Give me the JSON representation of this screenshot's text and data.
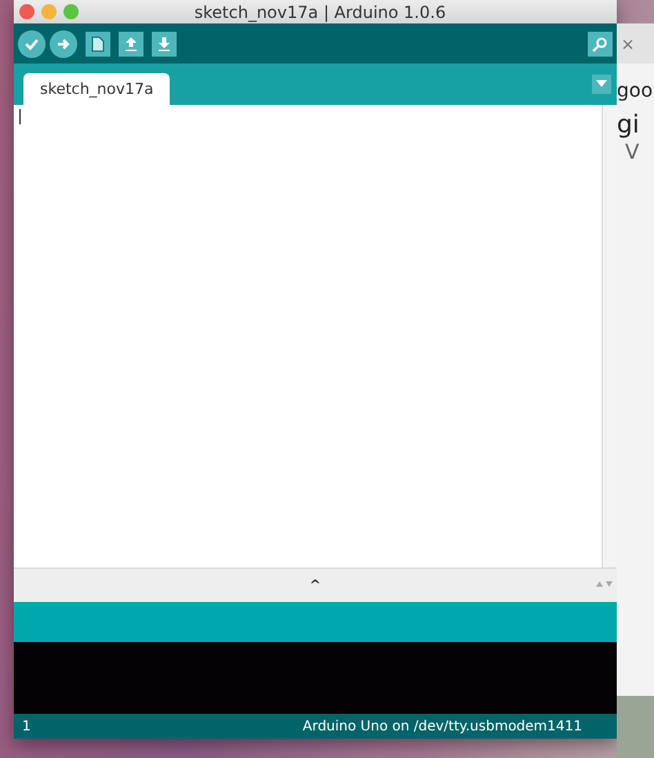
{
  "window": {
    "title": "sketch_nov17a | Arduino 1.0.6"
  },
  "toolbar": {
    "buttons": [
      {
        "kind": "verify"
      },
      {
        "kind": "upload"
      },
      {
        "kind": "new"
      },
      {
        "kind": "open"
      },
      {
        "kind": "save"
      }
    ]
  },
  "tabs": [
    {
      "label": "sketch_nov17a",
      "selected": true
    }
  ],
  "editor": {
    "splitter": "^"
  },
  "status_bar": {
    "line": "1",
    "board": "Arduino Uno on /dev/tty.usbmodem1411"
  },
  "background_window": {
    "texts": [
      "×",
      "goo",
      "gi",
      "V"
    ]
  }
}
